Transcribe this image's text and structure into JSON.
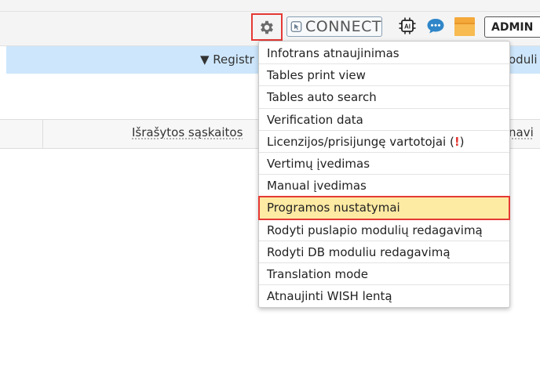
{
  "toolbar": {
    "connect_label": "CONNECT",
    "ai_label": "AI",
    "admin_label": "ADMIN"
  },
  "header": {
    "registry_text": "▼ Registr",
    "registry_right": "oduli"
  },
  "table": {
    "column_label": "Išrašytos sąskaitos",
    "column_right": "navi"
  },
  "menu": {
    "items": [
      {
        "label": "Infotrans atnaujinimas"
      },
      {
        "label": "Tables print view"
      },
      {
        "label": "Tables auto search"
      },
      {
        "label": "Verification data"
      },
      {
        "label": "Licenzijos/prisijungę vartotojai (",
        "warn": "!",
        "suffix": ")"
      },
      {
        "label": "Vertimų įvedimas"
      },
      {
        "label": "Manual įvedimas"
      },
      {
        "label": "Programos nustatymai"
      },
      {
        "label": "Rodyti puslapio modulių redagavimą"
      },
      {
        "label": "Rodyti DB moduliu redagavimą"
      },
      {
        "label": "Translation mode"
      },
      {
        "label": "Atnaujinti WISH lentą"
      }
    ]
  },
  "colors": {
    "highlight_bg": "#fdeaa3",
    "highlight_border": "#e53935",
    "registry_bar": "#cde6fb"
  }
}
